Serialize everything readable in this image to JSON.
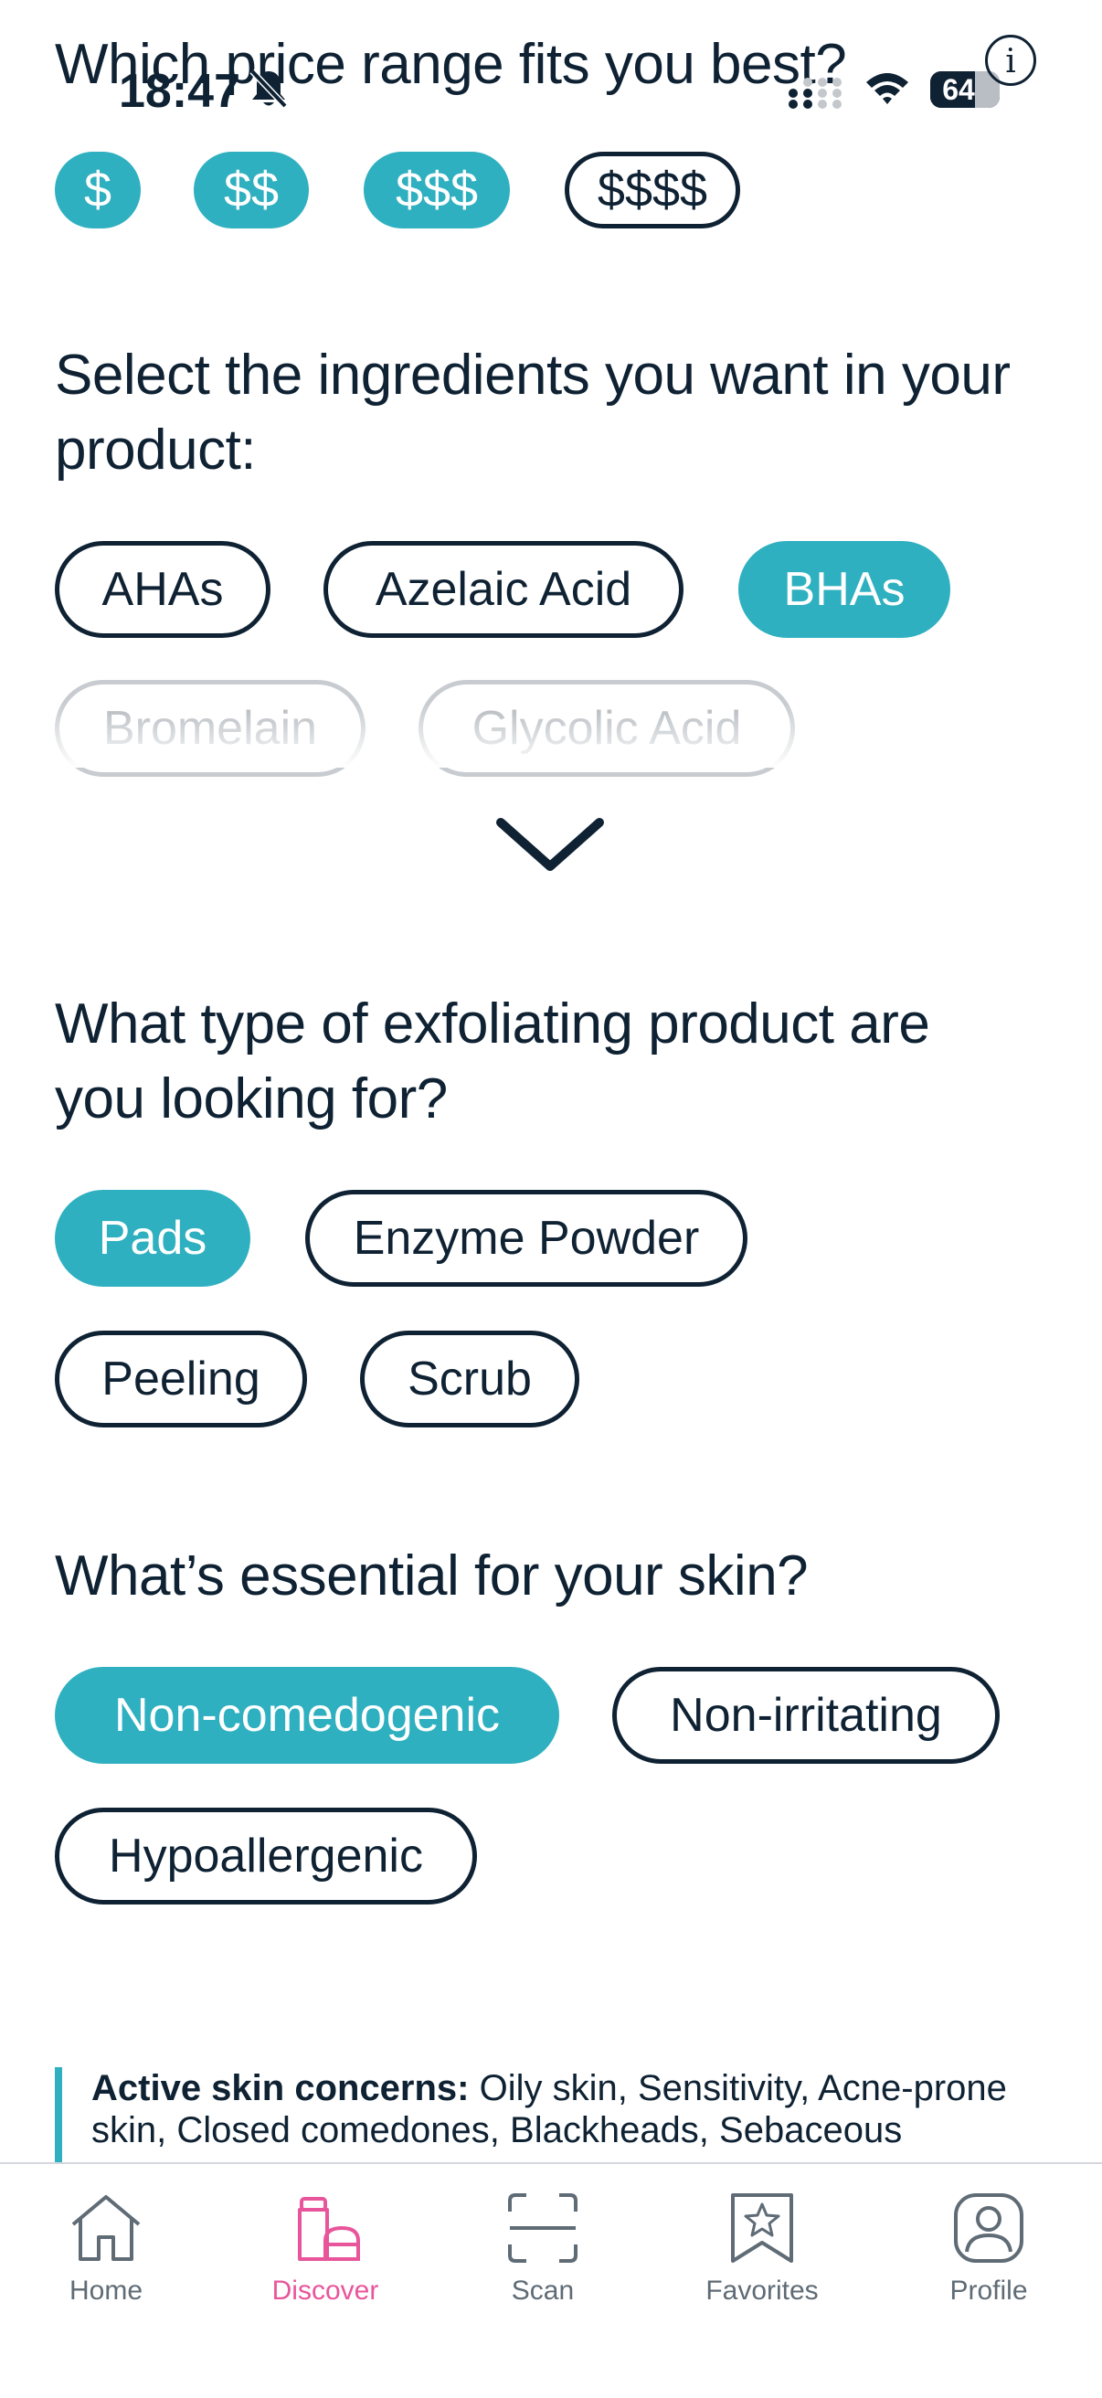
{
  "status_bar": {
    "time": "18:47",
    "battery": "64",
    "battery_level": 0.64,
    "icons": [
      "bell-slash-icon",
      "signal-icon",
      "wifi-icon",
      "battery-icon"
    ]
  },
  "header": {
    "info_icon": "info-icon",
    "info_glyph": "i"
  },
  "price": {
    "title": "Which price range fits you best?",
    "options": [
      {
        "label": "$",
        "selected": true
      },
      {
        "label": "$$",
        "selected": true
      },
      {
        "label": "$$$",
        "selected": true
      },
      {
        "label": "$$$$",
        "selected": false
      }
    ]
  },
  "ingredients": {
    "title": "Select the ingredients you want in your product:",
    "options": [
      {
        "label": "AHAs",
        "selected": false
      },
      {
        "label": "Azelaic Acid",
        "selected": false
      },
      {
        "label": "BHAs",
        "selected": true
      },
      {
        "label": "Bromelain",
        "selected": false
      },
      {
        "label": "Glycolic Acid",
        "selected": false
      }
    ],
    "expand_icon": "chevron-down-icon"
  },
  "product_type": {
    "title": "What type of exfoliating product are you looking for?",
    "options": [
      {
        "label": "Pads",
        "selected": true
      },
      {
        "label": "Enzyme Powder",
        "selected": false
      },
      {
        "label": "Peeling",
        "selected": false
      },
      {
        "label": "Scrub",
        "selected": false
      }
    ]
  },
  "essentials": {
    "title": "What’s essential for your skin?",
    "options": [
      {
        "label": "Non-comedogenic",
        "selected": true
      },
      {
        "label": "Non-irritating",
        "selected": false
      },
      {
        "label": "Hypoallergenic",
        "selected": false
      }
    ]
  },
  "concerns": {
    "label": "Active skin concerns:",
    "text": " Oily skin, Sensitivity, Acne-prone skin, Closed comedones, Blackheads, Sebaceous"
  },
  "tabbar": {
    "tabs": [
      {
        "label": "Home",
        "icon": "home-icon",
        "active": false
      },
      {
        "label": "Discover",
        "icon": "discover-icon",
        "active": true
      },
      {
        "label": "Scan",
        "icon": "scan-icon",
        "active": false
      },
      {
        "label": "Favorites",
        "icon": "favorites-icon",
        "active": false
      },
      {
        "label": "Profile",
        "icon": "profile-icon",
        "active": false
      }
    ]
  },
  "colors": {
    "accent": "#2fb0c0",
    "text": "#0f2233",
    "active_tab": "#e8559a",
    "inactive_tab": "#5f6b75"
  }
}
